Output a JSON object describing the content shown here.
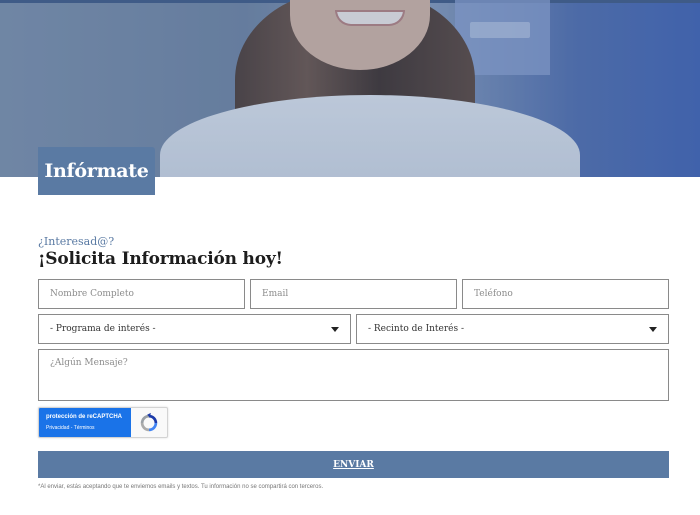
{
  "hero": {
    "tab_label": "Infórmate"
  },
  "form": {
    "kicker": "¿Interesad@?",
    "headline": "¡Solicita Información hoy!",
    "fields": {
      "name_placeholder": "Nombre Completo",
      "email_placeholder": "Email",
      "phone_placeholder": "Teléfono",
      "program_selected": "- Programa de interés -",
      "campus_selected": "- Recinto de Interés -",
      "message_placeholder": "¿Algún Mensaje?"
    },
    "recaptcha": {
      "title": "protección de reCAPTCHA",
      "links": "Privacidad - Términos"
    },
    "submit_label": "ENVIAR",
    "disclaimer": "*Al enviar, estás aceptando que te enviemos emails y textos. Tu información no se compartirá con terceros."
  },
  "colors": {
    "accent": "#5a7aa3",
    "recaptcha_blue": "#1a73e8"
  },
  "icons": {
    "select_caret": "chevron-down-icon",
    "recaptcha_logo": "recaptcha-icon"
  }
}
